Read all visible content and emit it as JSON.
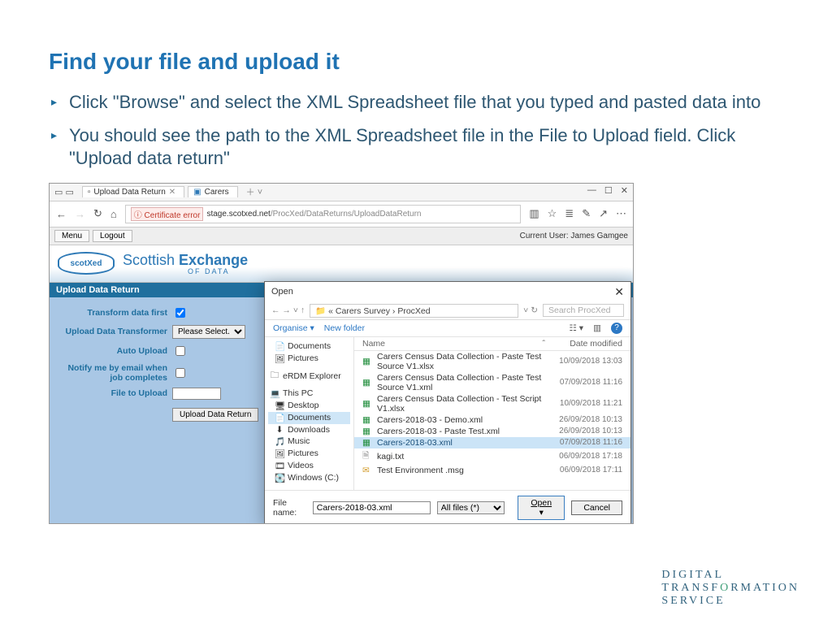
{
  "title": "Find your file and upload it",
  "bullets": [
    "Click \"Browse\" and select the XML Spreadsheet file that you typed and pasted data into",
    "You should see the path to the XML Spreadsheet file in the File to Upload field. Click \"Upload data return\""
  ],
  "browser": {
    "tabs": [
      {
        "label": "Upload Data Return"
      },
      {
        "label": "Carers"
      }
    ],
    "url_host": "stage.scotxed.net",
    "url_path": "/ProcXed/DataReturns/UploadDataReturn",
    "cert_error": "Certificate error",
    "menu_btn": "Menu",
    "logout_btn": "Logout",
    "current_user_label": "Current User:",
    "current_user_name": "James Gamgee",
    "brand_logo": "scotXed",
    "brand_line1": "Scottish",
    "brand_line2": "Exchange",
    "brand_sub": "OF DATA"
  },
  "form": {
    "panel_title": "Upload Data Return",
    "transform_label": "Transform data first",
    "transformer_label": "Upload Data Transformer",
    "transformer_value": "Please Select...",
    "auto_upload_label": "Auto Upload",
    "notify_label": "Notify me by email when job completes",
    "file_label": "File to Upload",
    "submit_btn": "Upload Data Return"
  },
  "dialog": {
    "title": "Open",
    "path": "« Carers Survey › ProcXed",
    "search_placeholder": "Search ProcXed",
    "organize": "Organise ▾",
    "new_folder": "New folder",
    "col_name": "Name",
    "col_date": "Date modified",
    "sidebar": [
      {
        "icon": "📄",
        "label": "Documents"
      },
      {
        "icon": "🖼",
        "label": "Pictures"
      },
      {
        "icon": "🗀",
        "label": "eRDM Explorer",
        "group": true
      },
      {
        "icon": "💻",
        "label": "This PC",
        "group": true
      },
      {
        "icon": "🖥",
        "label": "Desktop"
      },
      {
        "icon": "📄",
        "label": "Documents",
        "selected": true
      },
      {
        "icon": "⬇",
        "label": "Downloads"
      },
      {
        "icon": "🎵",
        "label": "Music"
      },
      {
        "icon": "🖼",
        "label": "Pictures"
      },
      {
        "icon": "🎞",
        "label": "Videos"
      },
      {
        "icon": "💽",
        "label": "Windows (C:)"
      }
    ],
    "files": [
      {
        "icon": "x",
        "name": "Carers Census Data Collection - Paste Test Source V1.xlsx",
        "date": "10/09/2018 13:03"
      },
      {
        "icon": "x",
        "name": "Carers Census Data Collection - Paste Test Source V1.xml",
        "date": "07/09/2018 11:16"
      },
      {
        "icon": "x",
        "name": "Carers Census Data Collection - Test Script V1.xlsx",
        "date": "10/09/2018 11:21"
      },
      {
        "icon": "x",
        "name": "Carers-2018-03 - Demo.xml",
        "date": "26/09/2018 10:13"
      },
      {
        "icon": "x",
        "name": "Carers-2018-03 - Paste Test.xml",
        "date": "26/09/2018 10:13"
      },
      {
        "icon": "x",
        "name": "Carers-2018-03.xml",
        "date": "07/09/2018 11:16",
        "selected": true
      },
      {
        "icon": "t",
        "name": "kagi.txt",
        "date": "06/09/2018 17:18"
      },
      {
        "icon": "m",
        "name": "Test Environment .msg",
        "date": "06/09/2018 17:11"
      }
    ],
    "file_field_label": "File name:",
    "file_field_value": "Carers-2018-03.xml",
    "filter": "All files (*)",
    "open_btn": "Open",
    "cancel_btn": "Cancel"
  },
  "footer": {
    "line1": "DIGITAL",
    "line2a": "TRANSF",
    "line2o": "O",
    "line2b": "RMATION",
    "line3": "SERVICE"
  }
}
